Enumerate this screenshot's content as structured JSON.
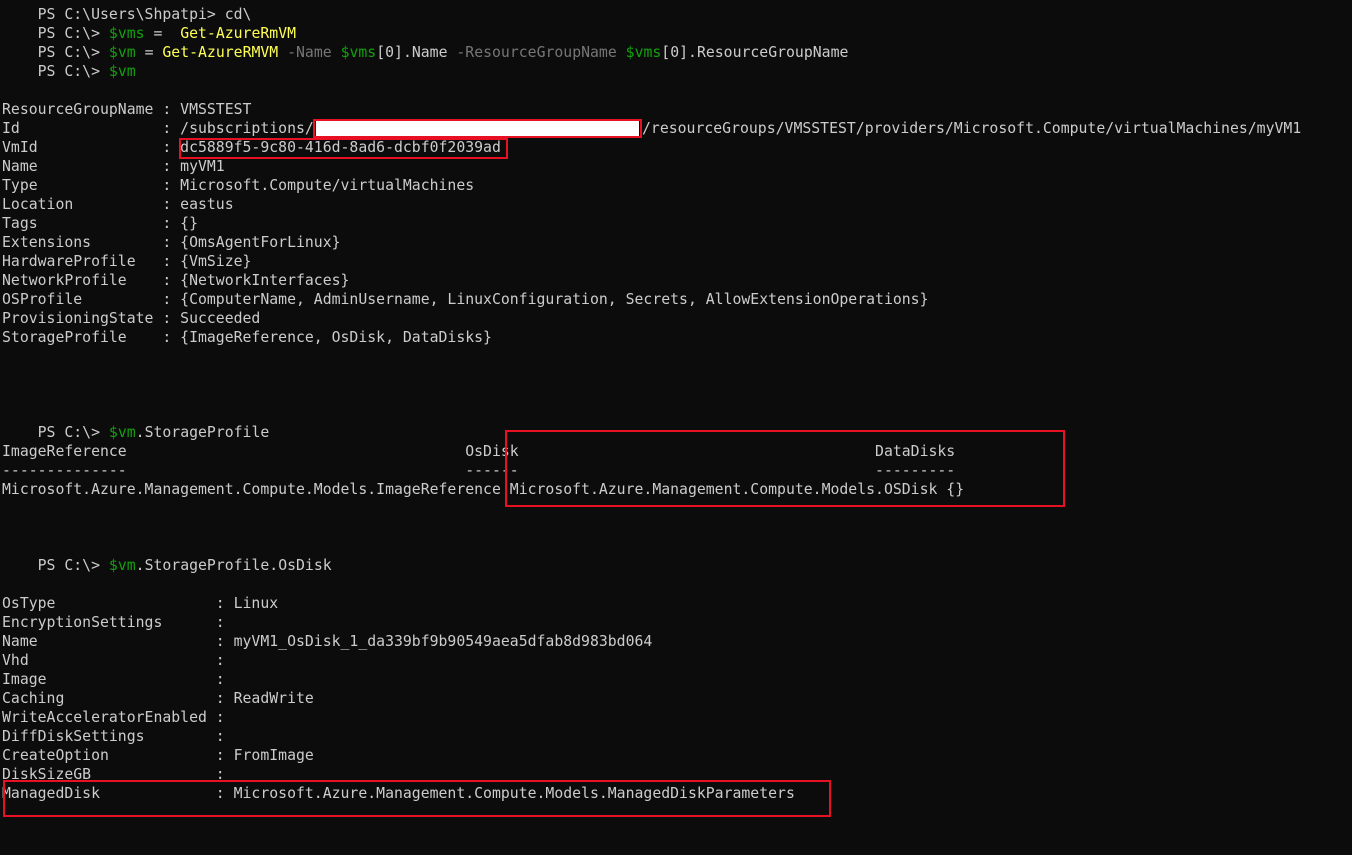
{
  "prompt": "PS C:\\> ",
  "partial_top": "PS C:\\Users\\Shpatpi> cd\\",
  "commands": {
    "c1": {
      "var": "$vms",
      "op": " =  ",
      "cmd": "Get-AzureRmVM"
    },
    "c2": {
      "var": "$vm",
      "op": " = ",
      "cmd": "Get-AzureRMVM",
      "p1": " -Name ",
      "v1": "$vms",
      "idx1": "[0]",
      "prop1": ".Name",
      "p2": " -ResourceGroupName ",
      "v2": "$vms",
      "idx2": "[0]",
      "prop2": ".ResourceGroupName"
    },
    "c3": {
      "var": "$vm"
    },
    "c4": {
      "var": "$vm",
      "rest": ".StorageProfile"
    },
    "c5": {
      "var": "$vm",
      "rest": ".StorageProfile.OsDisk"
    }
  },
  "vm_props": [
    "ResourceGroupName : VMSSTEST",
    "Id                : /subscriptions/",
    "VmId              : dc5889f5-9c80-416d-8ad6-dcbf0f2039ad",
    "Name              : myVM1",
    "Type              : Microsoft.Compute/virtualMachines",
    "Location          : eastus",
    "Tags              : {}",
    "Extensions        : {OmsAgentForLinux}",
    "HardwareProfile   : {VmSize}",
    "NetworkProfile    : {NetworkInterfaces}",
    "OSProfile         : {ComputerName, AdminUsername, LinuxConfiguration, Secrets, AllowExtensionOperations}",
    "ProvisioningState : Succeeded",
    "StorageProfile    : {ImageReference, OsDisk, DataDisks}"
  ],
  "id_suffix": "/resourceGroups/VMSSTEST/providers/Microsoft.Compute/virtualMachines/myVM1",
  "storage_table": {
    "header": "ImageReference                                      OsDisk                                        DataDisks",
    "sep": "--------------                                      ------                                        ---------",
    "row": "Microsoft.Azure.Management.Compute.Models.ImageReference Microsoft.Azure.Management.Compute.Models.OSDisk {}"
  },
  "osdisk_props": [
    "OsType                  : Linux",
    "EncryptionSettings      :",
    "Name                    : myVM1_OsDisk_1_da339bf9b90549aea5dfab8d983bd064",
    "Vhd                     :",
    "Image                   :",
    "Caching                 : ReadWrite",
    "WriteAcceleratorEnabled :",
    "DiffDiskSettings        :",
    "CreateOption            : FromImage",
    "DiskSizeGB              :",
    "ManagedDisk             : Microsoft.Azure.Management.Compute.Models.ManagedDiskParameters"
  ],
  "colors": {
    "background": "#0c0c0c",
    "foreground": "#cccccc",
    "command": "#ffff55",
    "variable": "#13a10e",
    "parameter": "#767676",
    "highlight": "#e81123"
  }
}
